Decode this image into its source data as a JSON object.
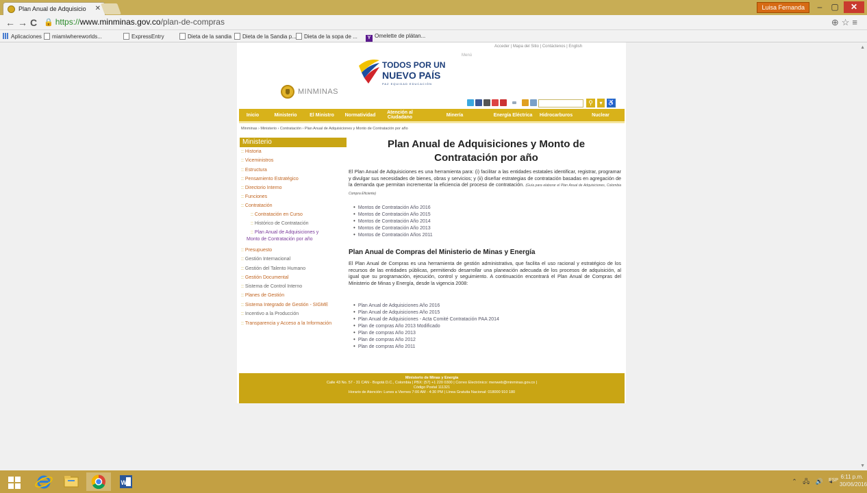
{
  "browser": {
    "tab_title": "Plan Anual de Adquisicio",
    "tab_close": "✕",
    "user_name": "Luisa Fernanda",
    "win_min": "–",
    "win_max": "▢",
    "win_close": "✕",
    "nav_back": "←",
    "nav_forward": "→",
    "nav_reload": "C",
    "url_scheme": "https://",
    "url_host": "www.minminas.gov.co",
    "url_path": "/plan-de-compras",
    "address_icons": "⊕☆≡",
    "bookmarks": [
      "Aplicaciones",
      "miamiwhereworlds...",
      "ExpressEntry",
      "Dieta de la sandia",
      "Dieta de la Sandia p...",
      "Dieta de la sopa de ...",
      "Omelette de plátan..."
    ]
  },
  "site": {
    "util_links": "Acceder  |  Mapa del Sitio  |  Contáctenos  |  English",
    "menu_label": "Menú",
    "logo_text": "MINMINAS",
    "slogan": {
      "line1": "TODOS POR UN",
      "line2": "NUEVO PAÍS",
      "line3": "PAZ  EQUIDAD  EDUCACIÓN"
    },
    "search_icon": "⚲",
    "chevron_icon": "▾",
    "access_icon": "♿",
    "nav": [
      "Inicio",
      "Ministerio",
      "El Ministro",
      "Normatividad",
      "Atención al Ciudadano",
      "Minería",
      "Energía Eléctrica",
      "Hidrocarburos",
      "Nuclear"
    ],
    "breadcrumb": "Minminas  ›  Ministerio  ›  Contratación  ›  Plan Anual de Adquisiciones y Monto de Contratación por año",
    "sidebar": {
      "header": "Ministerio",
      "bullet": "::",
      "items": [
        "Historia",
        "Viceministros",
        "Estructura",
        "Pensamiento Estratégico",
        "Directorio Interno",
        "Funciones",
        "Contratación",
        "Contratación en Curso",
        "Histórico de Contratación",
        "Plan Anual de Adquisiciones y",
        "Monto de Contratación por año",
        "Presupuesto",
        "Gestión Internacional",
        "Gestión del Talento Humano",
        "Gestión Documental",
        "Sistema de Control Interno",
        "Planes de Gestión",
        "Sistema Integrado de Gestión - SIGME",
        "Incentivo a la Producción",
        "Transparencia y Acceso a la Información"
      ]
    },
    "main": {
      "title": "Plan Anual de Adquisiciones y Monto de Contratación por año",
      "intro": "El Plan Anual de Adquisiciones es una herramienta para: (i) facilitar a las entidades estatales identificar, registrar, programar y divulgar sus necesidades de bienes, obras y servicios; y (ii) diseñar estrategias de contratación basadas en agregación de la demanda que permitan incrementar la eficiencia del proceso de contratación.",
      "intro_note": "(Guía para elaborar el Plan Anual de Adquisiciones, Colombia Compra Eficiente)",
      "bullet": "•",
      "montos": [
        "Montos de Contratación Año 2016",
        "Montos de Contratación Año 2015",
        "Montos de Contratación Año 2014",
        "Montos de Contratación Año 2013",
        "Montos de Contratación Años 2011"
      ],
      "subtitle": "Plan Anual de Compras del Ministerio de Minas y Energía",
      "compras_text": "El Plan Anual de Compras es una herramienta de gestión administrativa, que facilita el uso racional y estratégico de los recursos de las entidades públicas, permitiendo desarrollar una planeación adecuada de los procesos de adquisición, al igual que su programación, ejecución, control y seguimiento. A continuación encontrará el Plan Anual de Compras del Ministerio de Minas y Energía, desde la vigencia 2008:",
      "planes": [
        "Plan Anual de Adquisiciones Año 2016",
        "Plan Anual de Adquisiciones Año 2015",
        "Plan Anual de Adquisiciones - Acta Comité Contratación PAA 2014",
        "Plan de compras Año 2013 Modificado",
        "Plan de compras Año 2013",
        "Plan de compras Año 2012",
        "Plan de compras Año 2011"
      ]
    },
    "footer": {
      "line1": "Ministerio de Minas y Energía",
      "line2": "Calle 43 No. 57 - 31 CAN - Bogotá D.C., Colombia | PBX: (57) +1 220 0300 | Correo Electrónico: menweb@minminas.gov.co |",
      "line3": "Código Postal 111321",
      "line4": "Horario de Atención: Lunes a Viernes 7:00 AM - 4:30 PM | Línea Gratuita Nacional: 018000 910 180"
    }
  },
  "taskbar": {
    "tray": "⌃ 🖧 🔊 ◂",
    "lang": "ESP",
    "clock_time": "6:11 p.m.",
    "clock_date": "30/06/2016"
  },
  "colors": {
    "gold": "#d8b21a",
    "gold_dark": "#c9a514",
    "link_orange": "#c06420",
    "navy": "#1c3e7a"
  }
}
